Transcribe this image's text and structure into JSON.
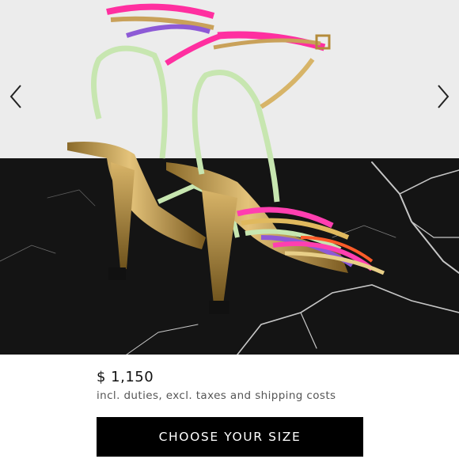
{
  "gallery": {
    "image_alt": "Multicolor strappy metallic gold high-heel sandals on black marble",
    "prev_icon": "chevron-left-icon",
    "next_icon": "chevron-right-icon"
  },
  "product": {
    "price": "$ 1,150",
    "price_note": "incl. duties, excl. taxes and shipping costs"
  },
  "cta": {
    "label": "CHOOSE YOUR SIZE"
  }
}
